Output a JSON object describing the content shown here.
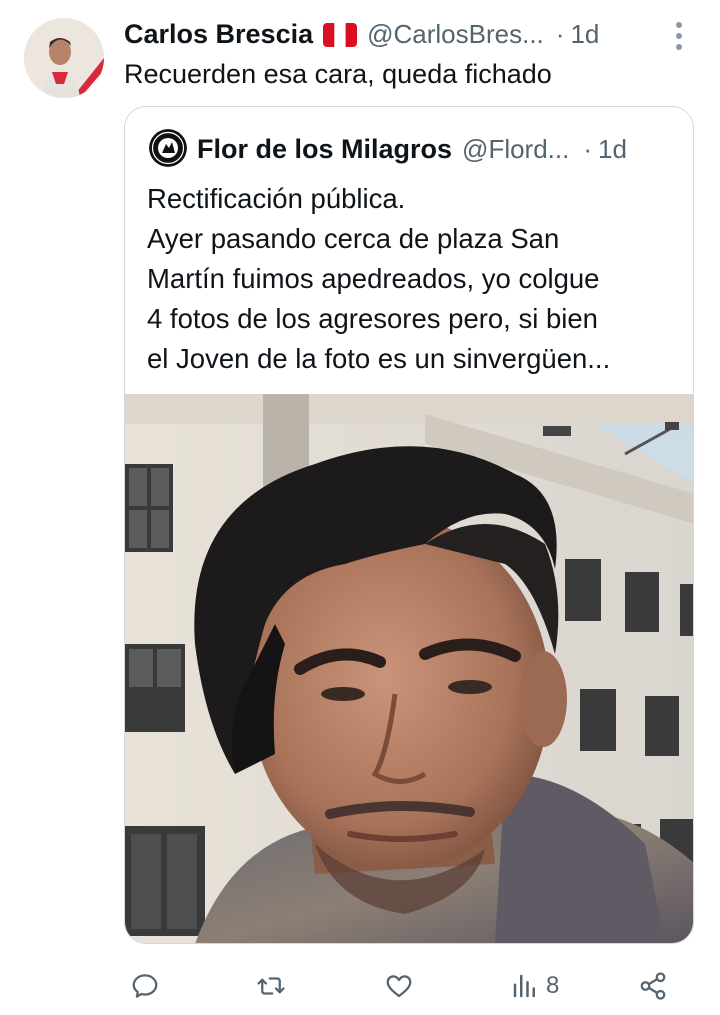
{
  "tweet": {
    "author": {
      "name": "Carlos Brescia",
      "flag": "peru-flag",
      "handle": "@CarlosBres...",
      "separator": "·",
      "time": "1d"
    },
    "text": "Recuerden esa cara, queda fichado",
    "menu_icon": "more-vertical-icon"
  },
  "quote": {
    "author": {
      "name": "Flor de los Milagros",
      "handle": "@Flord...",
      "separator": "·",
      "time": "1d"
    },
    "text_lines": [
      "Rectificación pública.",
      "Ayer pasando cerca de plaza San",
      "Martín fuimos apedreados, yo colgue",
      "4 fotos de los agresores pero, si bien",
      "el Joven de la foto es un sinvergüen..."
    ]
  },
  "actions": {
    "reply_icon": "reply-icon",
    "retweet_icon": "retweet-icon",
    "like_icon": "heart-icon",
    "views_icon": "views-icon",
    "views_count": "8",
    "share_icon": "share-icon"
  },
  "colors": {
    "text": "#0f1419",
    "secondary": "#536471",
    "border": "#cfd9de"
  }
}
